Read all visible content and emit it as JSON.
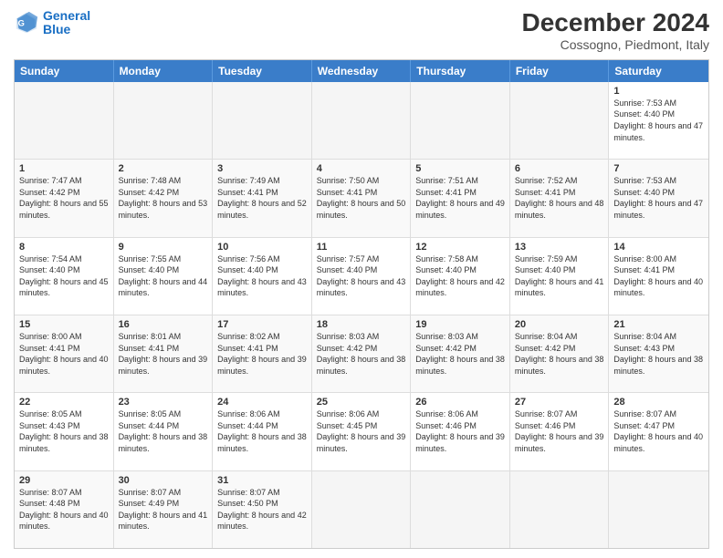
{
  "header": {
    "logo": {
      "line1": "General",
      "line2": "Blue"
    },
    "title": "December 2024",
    "subtitle": "Cossogno, Piedmont, Italy"
  },
  "calendar": {
    "days": [
      "Sunday",
      "Monday",
      "Tuesday",
      "Wednesday",
      "Thursday",
      "Friday",
      "Saturday"
    ],
    "weeks": [
      [
        {
          "day": "",
          "empty": true
        },
        {
          "day": "",
          "empty": true
        },
        {
          "day": "",
          "empty": true
        },
        {
          "day": "",
          "empty": true
        },
        {
          "day": "",
          "empty": true
        },
        {
          "day": "",
          "empty": true
        },
        {
          "num": "1",
          "sunrise": "7:53 AM",
          "sunset": "4:40 PM",
          "daylight": "8 hours and 47 minutes."
        }
      ],
      [
        {
          "num": "1",
          "sunrise": "7:47 AM",
          "sunset": "4:42 PM",
          "daylight": "8 hours and 55 minutes."
        },
        {
          "num": "2",
          "sunrise": "7:48 AM",
          "sunset": "4:42 PM",
          "daylight": "8 hours and 53 minutes."
        },
        {
          "num": "3",
          "sunrise": "7:49 AM",
          "sunset": "4:41 PM",
          "daylight": "8 hours and 52 minutes."
        },
        {
          "num": "4",
          "sunrise": "7:50 AM",
          "sunset": "4:41 PM",
          "daylight": "8 hours and 50 minutes."
        },
        {
          "num": "5",
          "sunrise": "7:51 AM",
          "sunset": "4:41 PM",
          "daylight": "8 hours and 49 minutes."
        },
        {
          "num": "6",
          "sunrise": "7:52 AM",
          "sunset": "4:41 PM",
          "daylight": "8 hours and 48 minutes."
        },
        {
          "num": "7",
          "sunrise": "7:53 AM",
          "sunset": "4:40 PM",
          "daylight": "8 hours and 47 minutes."
        }
      ],
      [
        {
          "num": "8",
          "sunrise": "7:54 AM",
          "sunset": "4:40 PM",
          "daylight": "8 hours and 45 minutes."
        },
        {
          "num": "9",
          "sunrise": "7:55 AM",
          "sunset": "4:40 PM",
          "daylight": "8 hours and 44 minutes."
        },
        {
          "num": "10",
          "sunrise": "7:56 AM",
          "sunset": "4:40 PM",
          "daylight": "8 hours and 43 minutes."
        },
        {
          "num": "11",
          "sunrise": "7:57 AM",
          "sunset": "4:40 PM",
          "daylight": "8 hours and 43 minutes."
        },
        {
          "num": "12",
          "sunrise": "7:58 AM",
          "sunset": "4:40 PM",
          "daylight": "8 hours and 42 minutes."
        },
        {
          "num": "13",
          "sunrise": "7:59 AM",
          "sunset": "4:40 PM",
          "daylight": "8 hours and 41 minutes."
        },
        {
          "num": "14",
          "sunrise": "8:00 AM",
          "sunset": "4:41 PM",
          "daylight": "8 hours and 40 minutes."
        }
      ],
      [
        {
          "num": "15",
          "sunrise": "8:00 AM",
          "sunset": "4:41 PM",
          "daylight": "8 hours and 40 minutes."
        },
        {
          "num": "16",
          "sunrise": "8:01 AM",
          "sunset": "4:41 PM",
          "daylight": "8 hours and 39 minutes."
        },
        {
          "num": "17",
          "sunrise": "8:02 AM",
          "sunset": "4:41 PM",
          "daylight": "8 hours and 39 minutes."
        },
        {
          "num": "18",
          "sunrise": "8:03 AM",
          "sunset": "4:42 PM",
          "daylight": "8 hours and 38 minutes."
        },
        {
          "num": "19",
          "sunrise": "8:03 AM",
          "sunset": "4:42 PM",
          "daylight": "8 hours and 38 minutes."
        },
        {
          "num": "20",
          "sunrise": "8:04 AM",
          "sunset": "4:42 PM",
          "daylight": "8 hours and 38 minutes."
        },
        {
          "num": "21",
          "sunrise": "8:04 AM",
          "sunset": "4:43 PM",
          "daylight": "8 hours and 38 minutes."
        }
      ],
      [
        {
          "num": "22",
          "sunrise": "8:05 AM",
          "sunset": "4:43 PM",
          "daylight": "8 hours and 38 minutes."
        },
        {
          "num": "23",
          "sunrise": "8:05 AM",
          "sunset": "4:44 PM",
          "daylight": "8 hours and 38 minutes."
        },
        {
          "num": "24",
          "sunrise": "8:06 AM",
          "sunset": "4:44 PM",
          "daylight": "8 hours and 38 minutes."
        },
        {
          "num": "25",
          "sunrise": "8:06 AM",
          "sunset": "4:45 PM",
          "daylight": "8 hours and 39 minutes."
        },
        {
          "num": "26",
          "sunrise": "8:06 AM",
          "sunset": "4:46 PM",
          "daylight": "8 hours and 39 minutes."
        },
        {
          "num": "27",
          "sunrise": "8:07 AM",
          "sunset": "4:46 PM",
          "daylight": "8 hours and 39 minutes."
        },
        {
          "num": "28",
          "sunrise": "8:07 AM",
          "sunset": "4:47 PM",
          "daylight": "8 hours and 40 minutes."
        }
      ],
      [
        {
          "num": "29",
          "sunrise": "8:07 AM",
          "sunset": "4:48 PM",
          "daylight": "8 hours and 40 minutes."
        },
        {
          "num": "30",
          "sunrise": "8:07 AM",
          "sunset": "4:49 PM",
          "daylight": "8 hours and 41 minutes."
        },
        {
          "num": "31",
          "sunrise": "8:07 AM",
          "sunset": "4:50 PM",
          "daylight": "8 hours and 42 minutes."
        },
        {
          "day": "",
          "empty": true
        },
        {
          "day": "",
          "empty": true
        },
        {
          "day": "",
          "empty": true
        },
        {
          "day": "",
          "empty": true
        }
      ]
    ]
  }
}
